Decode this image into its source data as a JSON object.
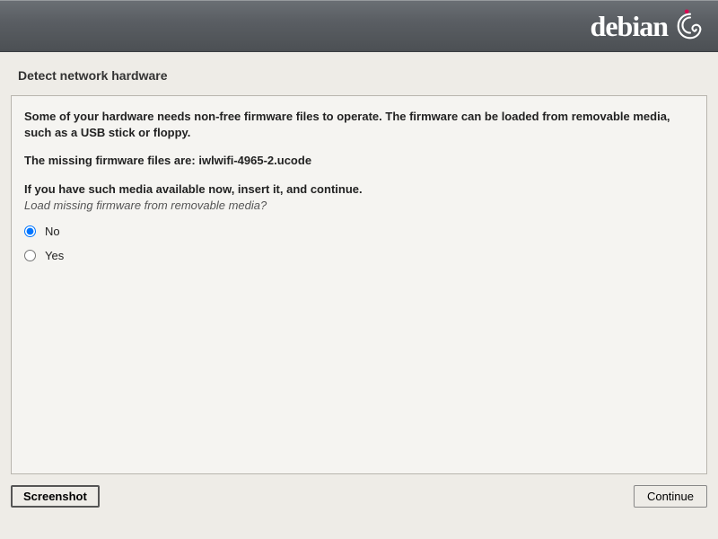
{
  "header": {
    "brand": "debian"
  },
  "page": {
    "title": "Detect network hardware"
  },
  "content": {
    "intro": "Some of your hardware needs non-free firmware files to operate. The firmware can be loaded from removable media, such as a USB stick or floppy.",
    "missing": "The missing firmware files are: iwlwifi-4965-2.ucode",
    "instruction": "If you have such media available now, insert it, and continue.",
    "prompt": "Load missing firmware from removable media?",
    "options": {
      "no": "No",
      "yes": "Yes"
    },
    "selected": "no"
  },
  "footer": {
    "screenshot": "Screenshot",
    "continue": "Continue"
  }
}
